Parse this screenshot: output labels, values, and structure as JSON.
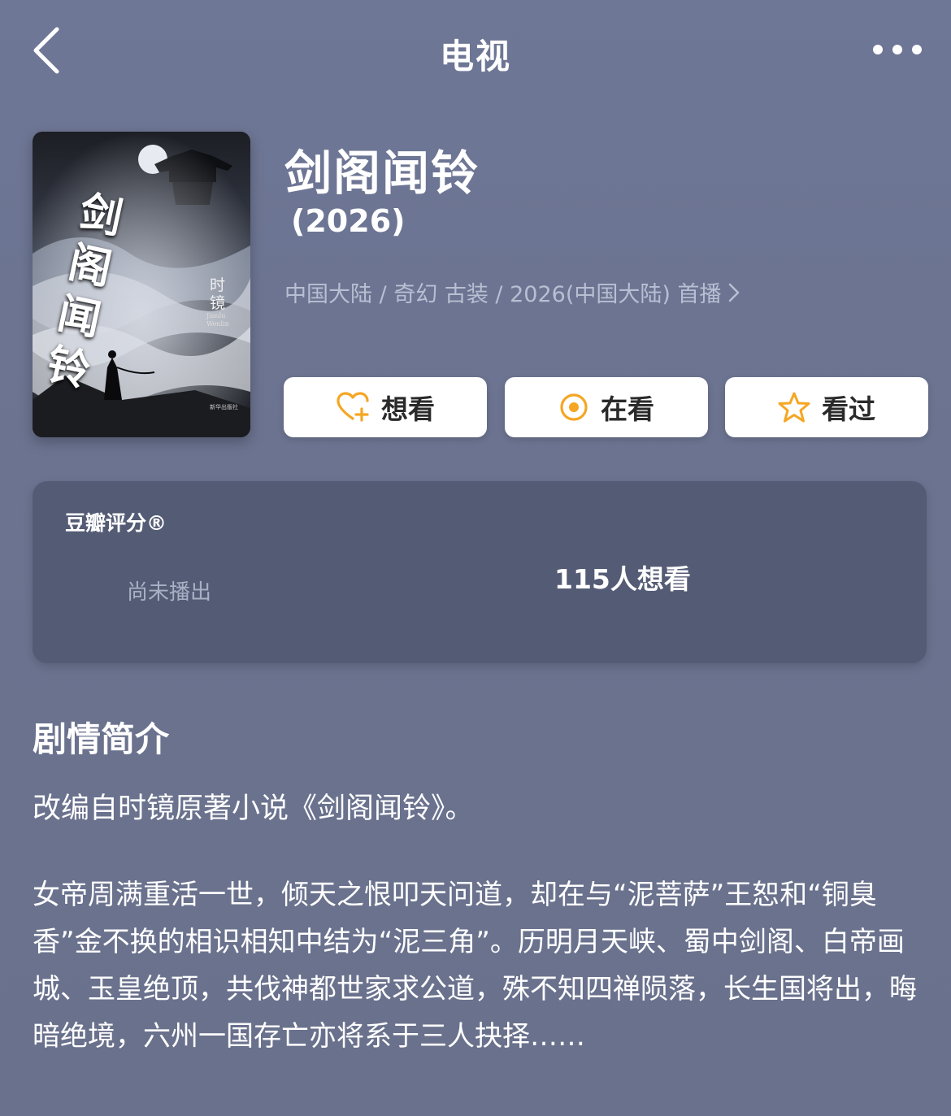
{
  "nav": {
    "title": "电视"
  },
  "poster": {
    "title": "剑阁闻铃",
    "author": "时镜",
    "subtitle": "Jianlu Wenlin",
    "publisher": "新华出版社"
  },
  "header": {
    "title": "剑阁闻铃",
    "year": "(2026)",
    "meta": "中国大陆 / 奇幻 古装 / 2026(中国大陆) 首播"
  },
  "actions": {
    "want": "想看",
    "watching": "在看",
    "watched": "看过"
  },
  "rating": {
    "label": "豆瓣评分®",
    "status": "尚未播出",
    "want_count": "115人想看"
  },
  "synopsis": {
    "heading": "剧情简介",
    "intro": "改编自时镜原著小说《剑阁闻铃》。",
    "body": "女帝周满重活一世，倾天之恨叩天问道，却在与“泥菩萨”王恕和“铜臭香”金不换的相识相知中结为“泥三角”。历明月天峡、蜀中剑阁、白帝画城、玉皇绝顶，共伐神都世家求公道，殊不知四禅陨落，长生国将出，晦暗绝境，六州一国存亡亦将系于三人抉择……"
  },
  "colors": {
    "background": "#6c7490",
    "card": "#545b75",
    "accent": "#f5a623",
    "muted_text": "#b9bfd2"
  },
  "icons": {
    "back": "chevron-left-icon",
    "more": "more-dots-icon",
    "want": "heart-plus-icon",
    "watching": "target-icon",
    "watched": "star-icon"
  }
}
